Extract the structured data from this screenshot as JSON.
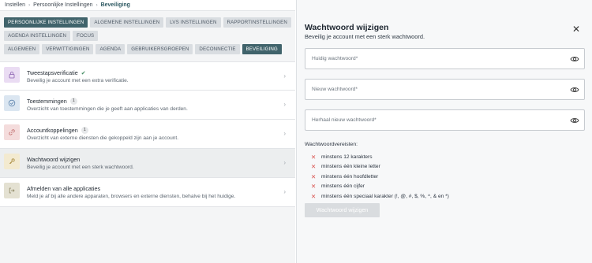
{
  "breadcrumb": {
    "items": [
      "Instellen",
      "Persoonlijke Instellingen",
      "Beveiliging"
    ]
  },
  "tabs_row1": [
    "PERSOONLIJKE INSTELLINGEN",
    "ALGEMENE INSTELLINGEN",
    "LVS INSTELLINGEN",
    "RAPPORTINSTELLINGEN"
  ],
  "tabs_row2": [
    "AGENDA INSTELLINGEN",
    "FOCUS"
  ],
  "tabs_row3": [
    "ALGEMEEN",
    "VERWITTIGINGEN",
    "AGENDA",
    "GEBRUIKERSGROEPEN",
    "DECONNECTIE",
    "BEVEILIGING"
  ],
  "list": [
    {
      "title": "Tweestapsverificatie",
      "desc": "Beveilig je account met een extra verificatie.",
      "badge": "",
      "icon": "lock-icon"
    },
    {
      "title": "Toestemmingen",
      "desc": "Overzicht van toestemmingen die je geeft aan applicaties van derden.",
      "badge": "1",
      "icon": "check-circle-icon"
    },
    {
      "title": "Accountkoppelingen",
      "desc": "Overzicht van externe diensten die gekoppeld zijn aan je account.",
      "badge": "1",
      "icon": "link-icon"
    },
    {
      "title": "Wachtwoord wijzigen",
      "desc": "Beveilig je account met een sterk wachtwoord.",
      "badge": "",
      "icon": "key-icon"
    },
    {
      "title": "Afmelden van alle applicaties",
      "desc": "Meld je af bij alle andere apparaten, browsers en externe diensten, behalve bij het huidige.",
      "badge": "",
      "icon": "sign-out-icon"
    }
  ],
  "panel": {
    "title": "Wachtwoord wijzigen",
    "subtitle": "Beveilig je account met een sterk wachtwoord.",
    "current_placeholder": "Huidig wachtwoord*",
    "new_placeholder": "Nieuw wachtwoord*",
    "repeat_placeholder": "Herhaal nieuw wachtwoord*",
    "requirements_title": "Wachtwoordvereisten:",
    "requirements": [
      "minstens 12 karakters",
      "minstens één kleine letter",
      "minstens één hoofdletter",
      "minstens één cijfer",
      "minstens één speciaal karakter (!, @, #, $, %, ^, & en *)"
    ],
    "submit_label": "Wachtwoord wijzigen"
  },
  "colors": {
    "accent": "#40636b",
    "error": "#d9534f",
    "success": "#3f8a60"
  }
}
